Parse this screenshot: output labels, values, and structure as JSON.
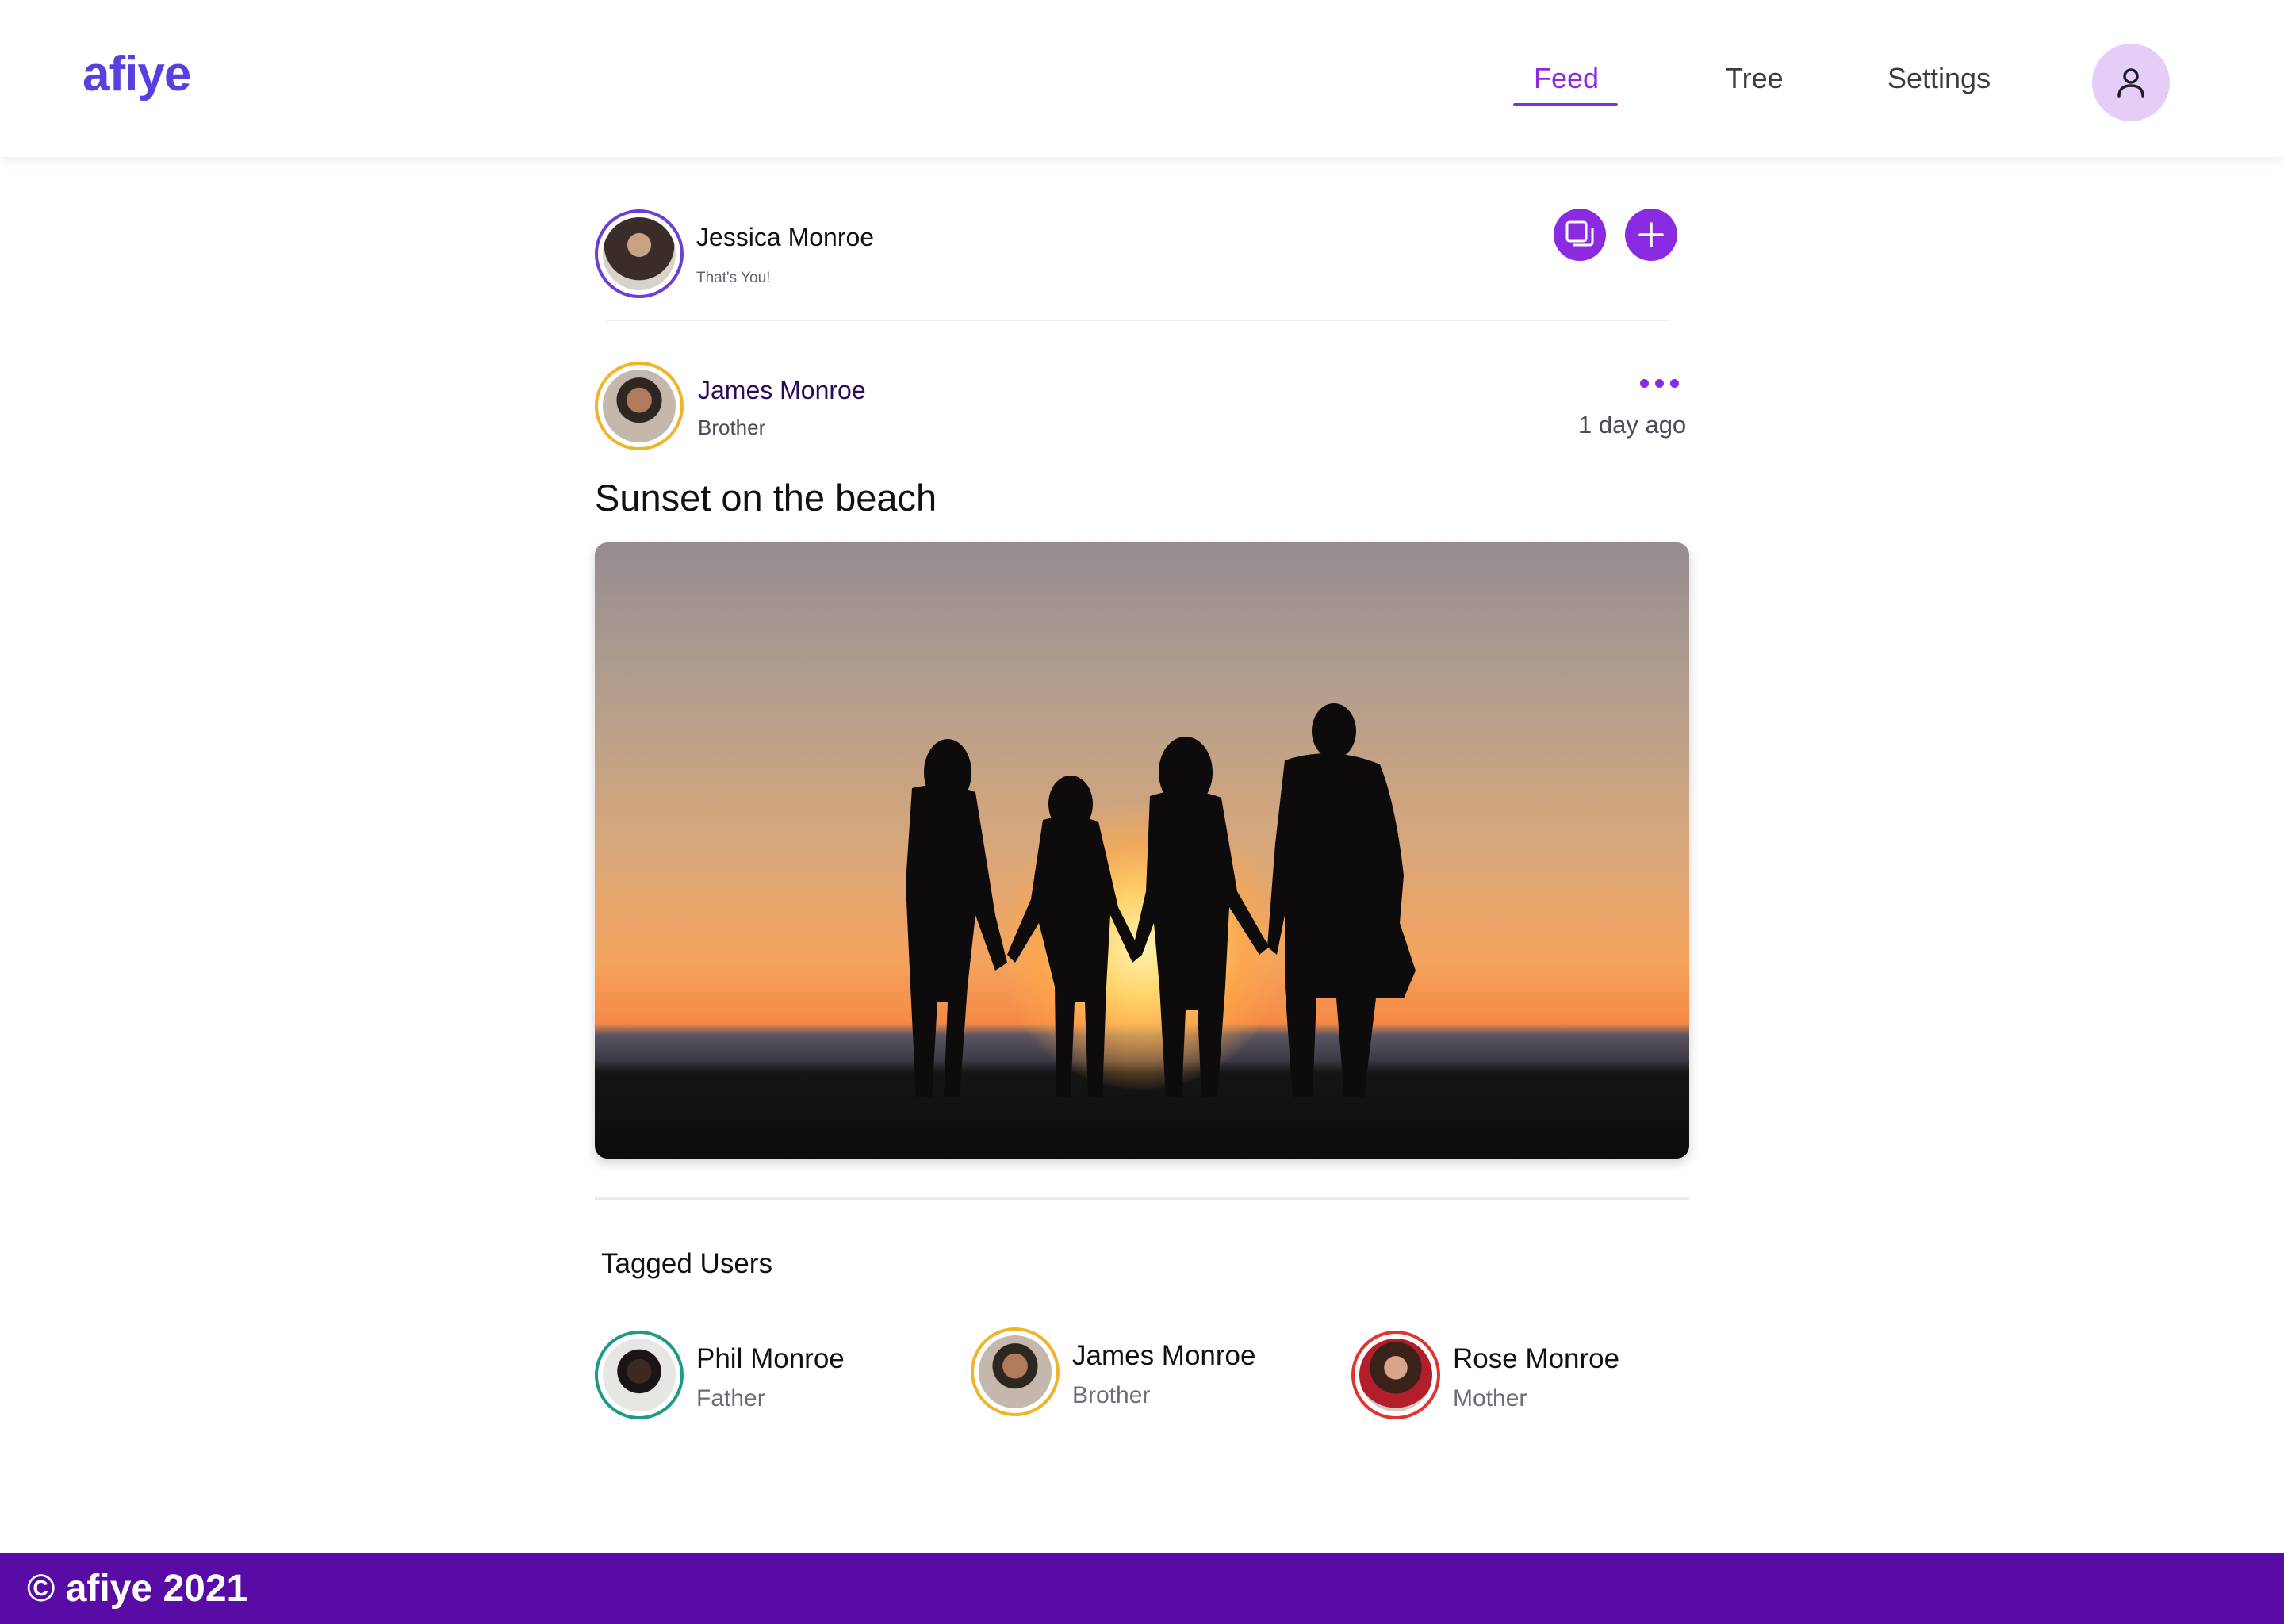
{
  "colors": {
    "brand": "#5a3fe0",
    "accent": "#8a2be2",
    "footer_bg": "#590ba6",
    "nav_text": "#3b3b48"
  },
  "app": {
    "logo": "afiye"
  },
  "nav": {
    "items": [
      {
        "label": "Feed",
        "active": true
      },
      {
        "label": "Tree",
        "active": false
      },
      {
        "label": "Settings",
        "active": false
      }
    ],
    "profile_icon": "user-icon"
  },
  "current_user": {
    "name": "Jessica Monroe",
    "subtitle": "That's You!",
    "actions": [
      {
        "icon": "gallery-icon"
      },
      {
        "icon": "plus-icon"
      }
    ]
  },
  "post": {
    "author_name": "James Monroe",
    "author_relation": "Brother",
    "time_ago": "1 day ago",
    "title": "Sunset on the beach",
    "menu_icon": "more-dots-icon"
  },
  "tagged": {
    "heading": "Tagged Users",
    "users": [
      {
        "name": "Phil Monroe",
        "relation": "Father"
      },
      {
        "name": "James Monroe",
        "relation": "Brother"
      },
      {
        "name": "Rose Monroe",
        "relation": "Mother"
      }
    ]
  },
  "footer": {
    "text": "© afiye 2021"
  }
}
